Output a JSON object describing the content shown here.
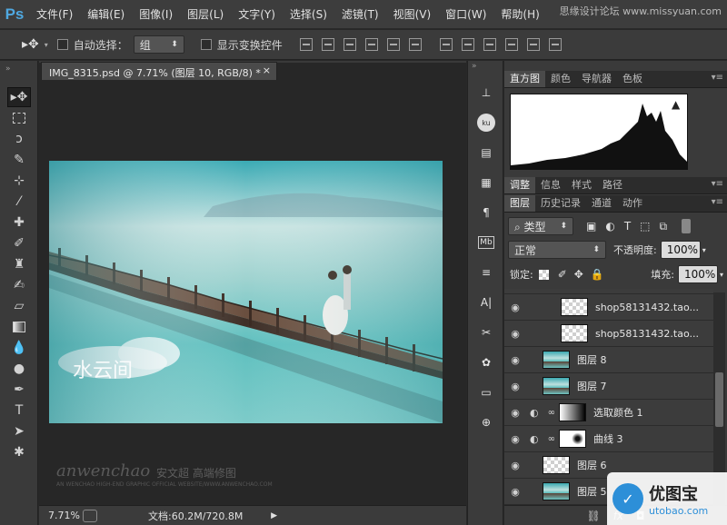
{
  "app": {
    "logo": "Ps",
    "watermark": "思缘设计论坛 www.missyuan.com"
  },
  "menu": [
    "文件(F)",
    "编辑(E)",
    "图像(I)",
    "图层(L)",
    "文字(Y)",
    "选择(S)",
    "滤镜(T)",
    "视图(V)",
    "窗口(W)",
    "帮助(H)"
  ],
  "options": {
    "auto_select_label": "自动选择：",
    "auto_select_value": "组",
    "show_transform_label": "显示变换控件"
  },
  "document": {
    "tab_title": "IMG_8315.psd @ 7.71% (图层 10, RGB/8) *",
    "zoom": "7.71%",
    "doc_info": "文档:60.2M/720.8M"
  },
  "artwork": {
    "cloud_text": "水云间",
    "signature": "anwenchao",
    "signature_cn": "安文超 高端修图",
    "signature_small": "AN WENCHAO HIGH-END GRAPHIC OFFICIAL WEBSITE/WWW.ANWENCHAO.COM"
  },
  "panels": {
    "top_tabs": [
      "直方图",
      "颜色",
      "导航器",
      "色板"
    ],
    "mid_tabs": [
      "调整",
      "信息",
      "样式",
      "路径"
    ],
    "layer_tabs": [
      "图层",
      "历史记录",
      "通道",
      "动作"
    ],
    "kind_filter": "类型",
    "blend_mode": "正常",
    "opacity_label": "不透明度:",
    "opacity_value": "100%",
    "lock_label": "锁定:",
    "fill_label": "填充:",
    "fill_value": "100%"
  },
  "layers": [
    {
      "name": "shop58131432.tao...",
      "thumb": "checker",
      "indent": 1
    },
    {
      "name": "shop58131432.tao...",
      "thumb": "checker",
      "indent": 1
    },
    {
      "name": "图层 8",
      "thumb": "photo",
      "indent": 0
    },
    {
      "name": "图层 7",
      "thumb": "photo",
      "indent": 0
    },
    {
      "name": "选取颜色 1",
      "thumb": "adj",
      "indent": 0
    },
    {
      "name": "曲线 3",
      "thumb": "curve",
      "indent": 0
    },
    {
      "name": "图层 6",
      "thumb": "checker",
      "indent": 0
    },
    {
      "name": "图层 5",
      "thumb": "photo",
      "indent": 0
    }
  ],
  "bottom_logo": {
    "brand": "优图宝",
    "url": "utobao.com"
  },
  "colors": {
    "accent": "#4fa8e0",
    "panel": "#3a3a3a",
    "sea": "#5fc4c4"
  }
}
